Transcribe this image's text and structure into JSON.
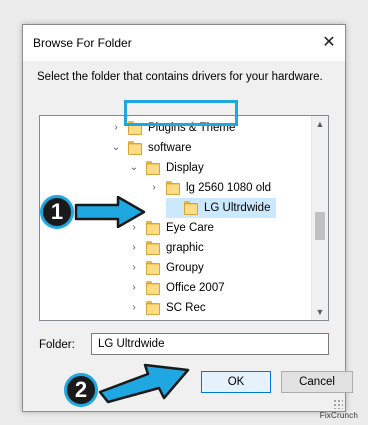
{
  "window": {
    "title": "Browse For Folder",
    "close_symbol": "✕"
  },
  "instruction": "Select the folder that contains drivers for your hardware.",
  "tree": {
    "items": [
      {
        "label": "Plugins & Theme",
        "chevron": "›",
        "level": 1
      },
      {
        "label": "software",
        "chevron": "⌄",
        "level": 1
      },
      {
        "label": "Display",
        "chevron": "⌄",
        "level": 2
      },
      {
        "label": "lg 2560 1080 old",
        "chevron": "›",
        "level": 3
      },
      {
        "label": "LG Ultrdwide",
        "chevron": "",
        "level": 3,
        "selected": true
      },
      {
        "label": "Eye Care",
        "chevron": "›",
        "level": 2
      },
      {
        "label": "graphic",
        "chevron": "›",
        "level": 2
      },
      {
        "label": "Groupy",
        "chevron": "›",
        "level": 2
      },
      {
        "label": "Office 2007",
        "chevron": "›",
        "level": 2
      },
      {
        "label": "SC Rec",
        "chevron": "›",
        "level": 2
      }
    ],
    "scroll_up": "▲",
    "scroll_down": "▼"
  },
  "folder_field": {
    "label": "Folder:",
    "value": "LG Ultrdwide"
  },
  "buttons": {
    "ok": "OK",
    "cancel": "Cancel"
  },
  "annotations": {
    "step1": "1",
    "step2": "2"
  },
  "watermark": "FixCrunch",
  "colors": {
    "accent": "#1ea7e1",
    "selection": "#cce8ff",
    "folder": "#f3c863"
  }
}
